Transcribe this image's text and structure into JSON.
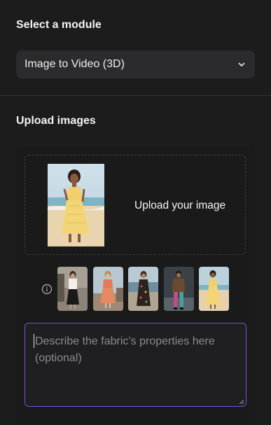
{
  "module_section": {
    "title": "Select a module",
    "selected": "Image to Video (3D)",
    "dropdown_icon": "chevron-down-icon"
  },
  "upload_section": {
    "title": "Upload images",
    "dropzone_label": "Upload your image",
    "preview_image": "woman-yellow-sundress-beach",
    "samples": [
      {
        "name": "woman-white-top-black-skirt"
      },
      {
        "name": "woman-coral-dress-rooftop"
      },
      {
        "name": "woman-floral-dress-seaside"
      },
      {
        "name": "man-jacket-patterned-pants-runway"
      },
      {
        "name": "woman-yellow-sundress-beach"
      }
    ],
    "info_icon": "info-icon"
  },
  "fabric": {
    "placeholder": "Describe the fabric’s properties here (optional)"
  },
  "colors": {
    "background": "#1c1c1d",
    "select_bg": "#2b2b2d",
    "focus_border": "#7d4fd6"
  }
}
